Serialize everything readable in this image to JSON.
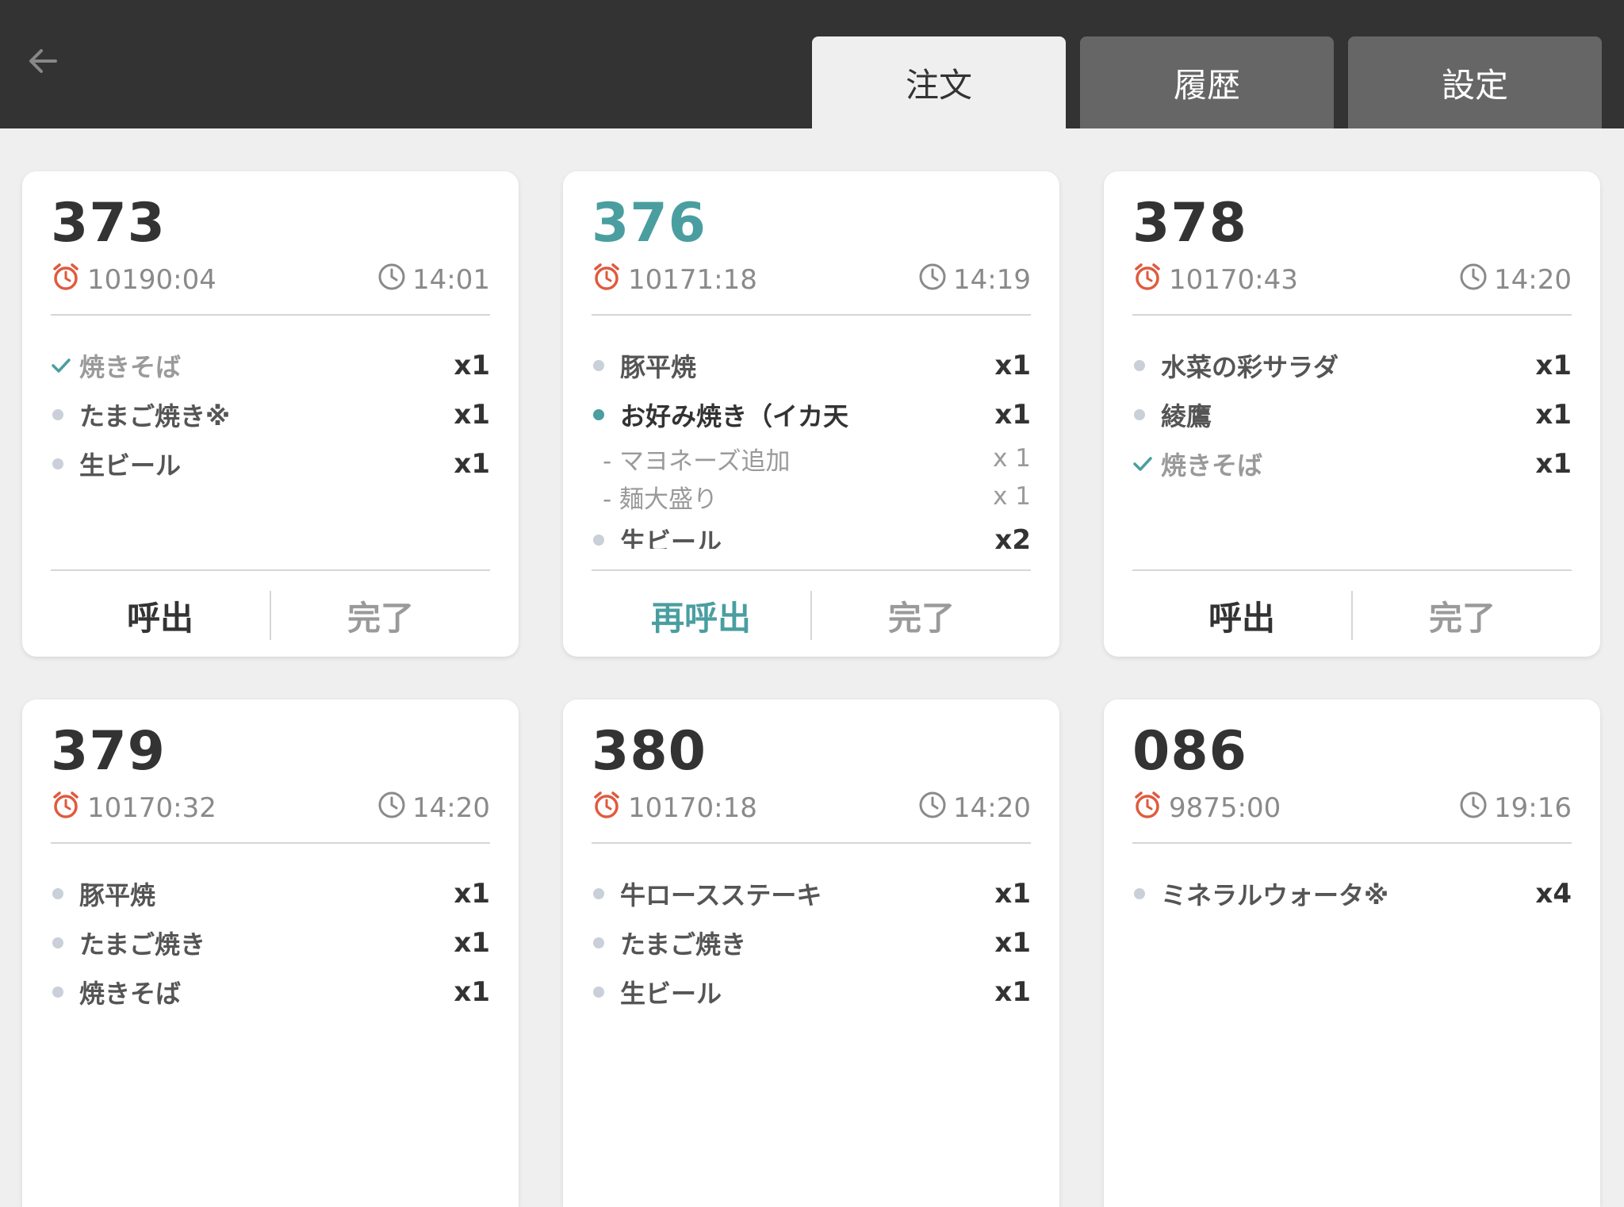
{
  "tabs": [
    {
      "label": "注文",
      "active": true
    },
    {
      "label": "履歴",
      "active": false
    },
    {
      "label": "設定",
      "active": false
    }
  ],
  "colors": {
    "accent": "#4a9ea0",
    "alarm": "#e05a3d",
    "header": "#333333"
  },
  "orders": [
    {
      "number": "373",
      "highlight": false,
      "elapsed": "10190:04",
      "time": "14:01",
      "items": [
        {
          "name": "焼きそば",
          "qty": "x1",
          "state": "done"
        },
        {
          "name": "たまご焼き※",
          "qty": "x1",
          "state": "pending"
        },
        {
          "name": "生ビール",
          "qty": "x1",
          "state": "pending"
        }
      ],
      "call_label": "呼出",
      "done_label": "完了"
    },
    {
      "number": "376",
      "highlight": true,
      "elapsed": "10171:18",
      "time": "14:19",
      "items": [
        {
          "name": "豚平焼",
          "qty": "x1",
          "state": "pending"
        },
        {
          "name": "お好み焼き（イカ天",
          "qty": "x1",
          "state": "active",
          "options": [
            {
              "name": "- マヨネーズ追加",
              "qty": "x 1"
            },
            {
              "name": "- 麺大盛り",
              "qty": "x 1"
            }
          ]
        },
        {
          "name": "生ビール",
          "qty": "x2",
          "state": "pending"
        }
      ],
      "call_label": "再呼出",
      "done_label": "完了"
    },
    {
      "number": "378",
      "highlight": false,
      "elapsed": "10170:43",
      "time": "14:20",
      "items": [
        {
          "name": "水菜の彩サラダ",
          "qty": "x1",
          "state": "pending"
        },
        {
          "name": "綾鷹",
          "qty": "x1",
          "state": "pending"
        },
        {
          "name": "焼きそば",
          "qty": "x1",
          "state": "done"
        }
      ],
      "call_label": "呼出",
      "done_label": "完了"
    },
    {
      "number": "379",
      "highlight": false,
      "elapsed": "10170:32",
      "time": "14:20",
      "items": [
        {
          "name": "豚平焼",
          "qty": "x1",
          "state": "pending"
        },
        {
          "name": "たまご焼き",
          "qty": "x1",
          "state": "pending"
        },
        {
          "name": "焼きそば",
          "qty": "x1",
          "state": "pending"
        }
      ]
    },
    {
      "number": "380",
      "highlight": false,
      "elapsed": "10170:18",
      "time": "14:20",
      "items": [
        {
          "name": "牛ロースステーキ",
          "qty": "x1",
          "state": "pending"
        },
        {
          "name": "たまご焼き",
          "qty": "x1",
          "state": "pending"
        },
        {
          "name": "生ビール",
          "qty": "x1",
          "state": "pending"
        }
      ]
    },
    {
      "number": "086",
      "highlight": false,
      "elapsed": "9875:00",
      "time": "19:16",
      "items": [
        {
          "name": "ミネラルウォータ※",
          "qty": "x4",
          "state": "pending"
        }
      ]
    }
  ]
}
